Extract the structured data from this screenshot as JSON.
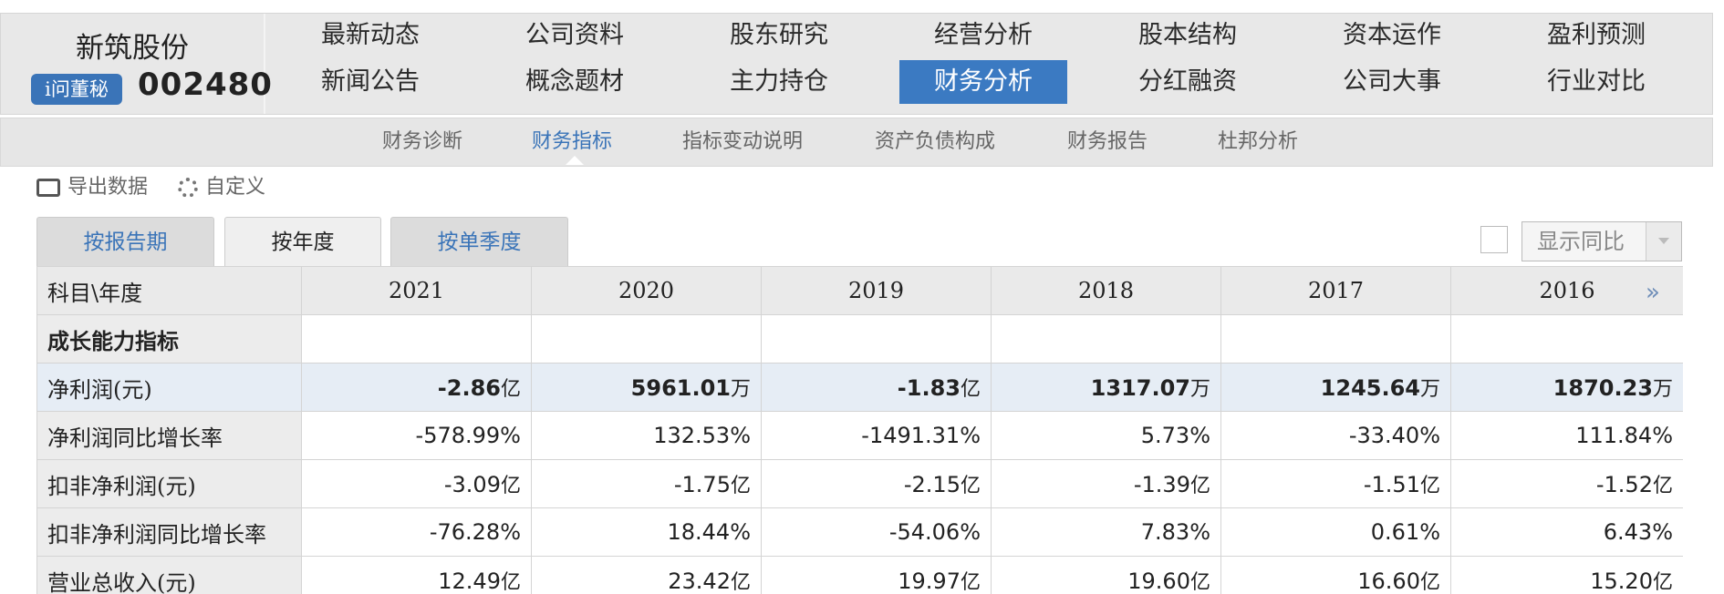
{
  "brand": {
    "name": "新筑股份",
    "badge": "i问董秘",
    "code": "002480"
  },
  "nav": {
    "row1": [
      "最新动态",
      "公司资料",
      "股东研究",
      "经营分析",
      "股本结构",
      "资本运作",
      "盈利预测"
    ],
    "row2": [
      "新闻公告",
      "概念题材",
      "主力持仓",
      "财务分析",
      "分红融资",
      "公司大事",
      "行业对比"
    ],
    "active": "财务分析"
  },
  "subnav": {
    "items": [
      "财务诊断",
      "财务指标",
      "指标变动说明",
      "资产负债构成",
      "财务报告",
      "杜邦分析"
    ],
    "active": "财务指标"
  },
  "toolbar": {
    "export": "导出数据",
    "custom": "自定义"
  },
  "tabs": [
    "按报告期",
    "按年度",
    "按单季度"
  ],
  "active_tab": "按年度",
  "compare": {
    "label": "显示同比"
  },
  "table": {
    "header_first": "科目\\年度",
    "years": [
      "2021",
      "2020",
      "2019",
      "2018",
      "2017",
      "2016"
    ],
    "rows": [
      {
        "label": "成长能力指标",
        "cells": [
          "",
          "",
          "",
          "",
          "",
          ""
        ]
      },
      {
        "label": "净利润(元)",
        "cells": [
          [
            "-2.86",
            "亿"
          ],
          [
            "5961.01",
            "万"
          ],
          [
            "-1.83",
            "亿"
          ],
          [
            "1317.07",
            "万"
          ],
          [
            "1245.64",
            "万"
          ],
          [
            "1870.23",
            "万"
          ]
        ]
      },
      {
        "label": "净利润同比增长率",
        "cells": [
          [
            "-578.99%",
            ""
          ],
          [
            "132.53%",
            ""
          ],
          [
            "-1491.31%",
            ""
          ],
          [
            "5.73%",
            ""
          ],
          [
            "-33.40%",
            ""
          ],
          [
            "111.84%",
            ""
          ]
        ]
      },
      {
        "label": "扣非净利润(元)",
        "cells": [
          [
            "-3.09",
            "亿"
          ],
          [
            "-1.75",
            "亿"
          ],
          [
            "-2.15",
            "亿"
          ],
          [
            "-1.39",
            "亿"
          ],
          [
            "-1.51",
            "亿"
          ],
          [
            "-1.52",
            "亿"
          ]
        ]
      },
      {
        "label": "扣非净利润同比增长率",
        "cells": [
          [
            "-76.28%",
            ""
          ],
          [
            "18.44%",
            ""
          ],
          [
            "-54.06%",
            ""
          ],
          [
            "7.83%",
            ""
          ],
          [
            "0.61%",
            ""
          ],
          [
            "6.43%",
            ""
          ]
        ]
      },
      {
        "label": "营业总收入(元)",
        "cells": [
          [
            "12.49",
            "亿"
          ],
          [
            "23.42",
            "亿"
          ],
          [
            "19.97",
            "亿"
          ],
          [
            "19.60",
            "亿"
          ],
          [
            "16.60",
            "亿"
          ],
          [
            "15.20",
            "亿"
          ]
        ]
      }
    ]
  },
  "more_icon": "»"
}
